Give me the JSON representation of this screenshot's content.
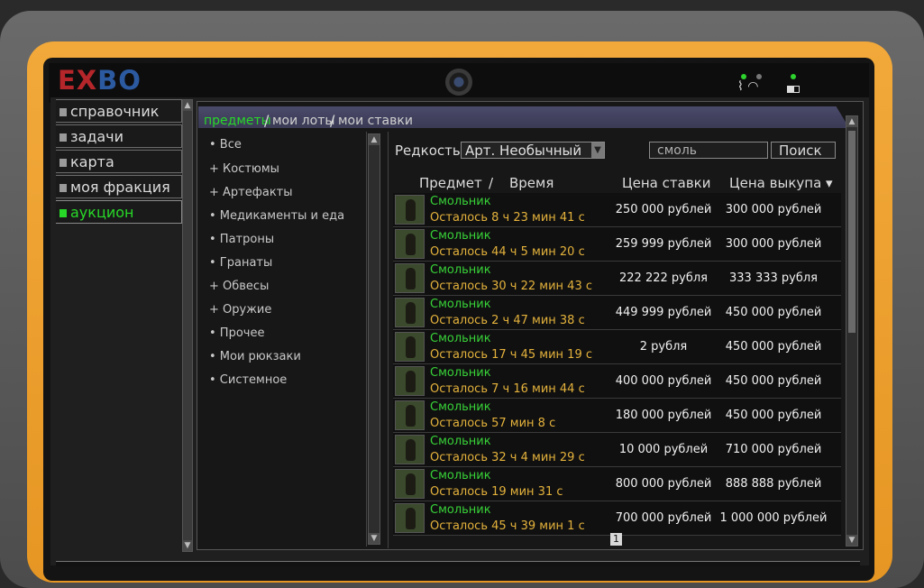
{
  "logo": {
    "part1": "EX",
    "part2": "BO"
  },
  "menu": [
    {
      "label": "справочник",
      "active": false
    },
    {
      "label": "задачи",
      "active": false
    },
    {
      "label": "карта",
      "active": false
    },
    {
      "label": "моя фракция",
      "active": false
    },
    {
      "label": "аукцион",
      "active": true
    }
  ],
  "tabs": {
    "items": "предметы",
    "my_lots": "мои лоты",
    "my_bids": "мои ставки",
    "sep": "/"
  },
  "categories": [
    "• Все",
    "+ Костюмы",
    "+ Артефакты",
    "• Медикаменты и еда",
    "• Патроны",
    "• Гранаты",
    "+ Обвесы",
    "+ Оружие",
    "• Прочее",
    "• Мои рюкзаки",
    "• Системное"
  ],
  "filter": {
    "label": "Редкость",
    "selected": "Арт. Необычный",
    "search_value": "смоль",
    "search_button": "Поиск"
  },
  "columns": {
    "item": "Предмет",
    "sep": "/",
    "time": "Время",
    "bid": "Цена ставки",
    "buyout": "Цена выкупа ▾"
  },
  "rows": [
    {
      "name": "Смольник",
      "time": "Осталось 8 ч 23 мин 41 с",
      "bid": "250 000 рублей",
      "buyout": "300 000 рублей"
    },
    {
      "name": "Смольник",
      "time": "Осталось 44 ч 5 мин 20 с",
      "bid": "259 999 рублей",
      "buyout": "300 000 рублей"
    },
    {
      "name": "Смольник",
      "time": "Осталось 30 ч 22 мин 43 с",
      "bid": "222 222 рубля",
      "buyout": "333 333 рубля"
    },
    {
      "name": "Смольник",
      "time": "Осталось 2 ч 47 мин 38 с",
      "bid": "449 999 рублей",
      "buyout": "450 000 рублей"
    },
    {
      "name": "Смольник",
      "time": "Осталось 17 ч 45 мин 19 с",
      "bid": "2 рубля",
      "buyout": "450 000 рублей"
    },
    {
      "name": "Смольник",
      "time": "Осталось 7 ч 16 мин 44 с",
      "bid": "400 000 рублей",
      "buyout": "450 000 рублей"
    },
    {
      "name": "Смольник",
      "time": "Осталось 57 мин 8 с",
      "bid": "180 000 рублей",
      "buyout": "450 000 рублей"
    },
    {
      "name": "Смольник",
      "time": "Осталось 32 ч 4 мин 29 с",
      "bid": "10 000 рублей",
      "buyout": "710 000 рублей"
    },
    {
      "name": "Смольник",
      "time": "Осталось 19 мин 31 с",
      "bid": "800 000 рублей",
      "buyout": "888 888 рублей"
    },
    {
      "name": "Смольник",
      "time": "Осталось 45 ч 39 мин 1 с",
      "bid": "700 000 рублей",
      "buyout": "1 000 000 рублей"
    }
  ],
  "pagination": {
    "current": "1"
  },
  "icons": {
    "wifi": "signal-wifi-icon",
    "battery": "battery-icon"
  }
}
